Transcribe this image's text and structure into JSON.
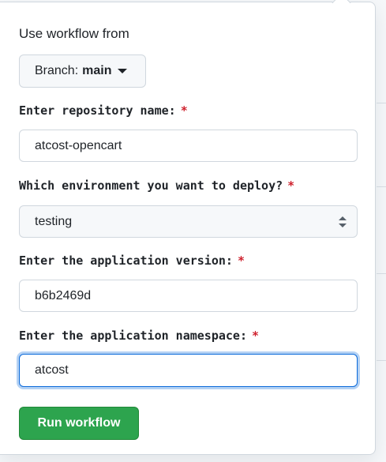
{
  "dialog": {
    "heading": "Use workflow from",
    "branch": {
      "prefix": "Branch:",
      "name": "main"
    }
  },
  "fields": [
    {
      "label": "Enter repository name:",
      "required_mark": "*",
      "value": "atcost-opencart",
      "kind": "text"
    },
    {
      "label": "Which environment you want to deploy?",
      "required_mark": "*",
      "value": "testing",
      "kind": "select"
    },
    {
      "label": "Enter the application version:",
      "required_mark": "*",
      "value": "b6b2469d",
      "kind": "text"
    },
    {
      "label": "Enter the application namespace:",
      "required_mark": "*",
      "value": "atcost",
      "kind": "text",
      "focused": true
    }
  ],
  "actions": {
    "run_label": "Run workflow"
  },
  "colors": {
    "primary_button": "#2da44e",
    "required": "#cf222e",
    "focus_ring": "#0969da"
  }
}
